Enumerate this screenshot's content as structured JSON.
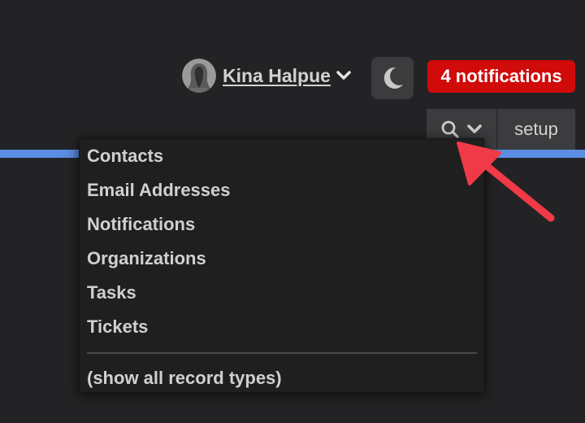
{
  "header": {
    "user_name": "Kina Halpue",
    "notifications_label": "4 notifications",
    "avatar_icon": "user-avatar-silhouette",
    "theme_icon": "moon-icon",
    "chevron_icon": "chevron-down-icon"
  },
  "nav": {
    "search_icon": "search-icon",
    "search_chevron_icon": "chevron-down-icon",
    "setup_label": "setup"
  },
  "dropdown": {
    "items": [
      {
        "label": "Contacts"
      },
      {
        "label": "Email Addresses"
      },
      {
        "label": "Notifications"
      },
      {
        "label": "Organizations"
      },
      {
        "label": "Tasks"
      },
      {
        "label": "Tickets"
      }
    ],
    "show_all_label": "(show all record types)"
  },
  "annotation": {
    "arrow_icon": "red-pointer-arrow",
    "color": "#f03a47"
  },
  "colors": {
    "background": "#232325",
    "accent_line": "#5b8de2",
    "badge": "#d10a0a",
    "tab": "#3c3c3f"
  }
}
